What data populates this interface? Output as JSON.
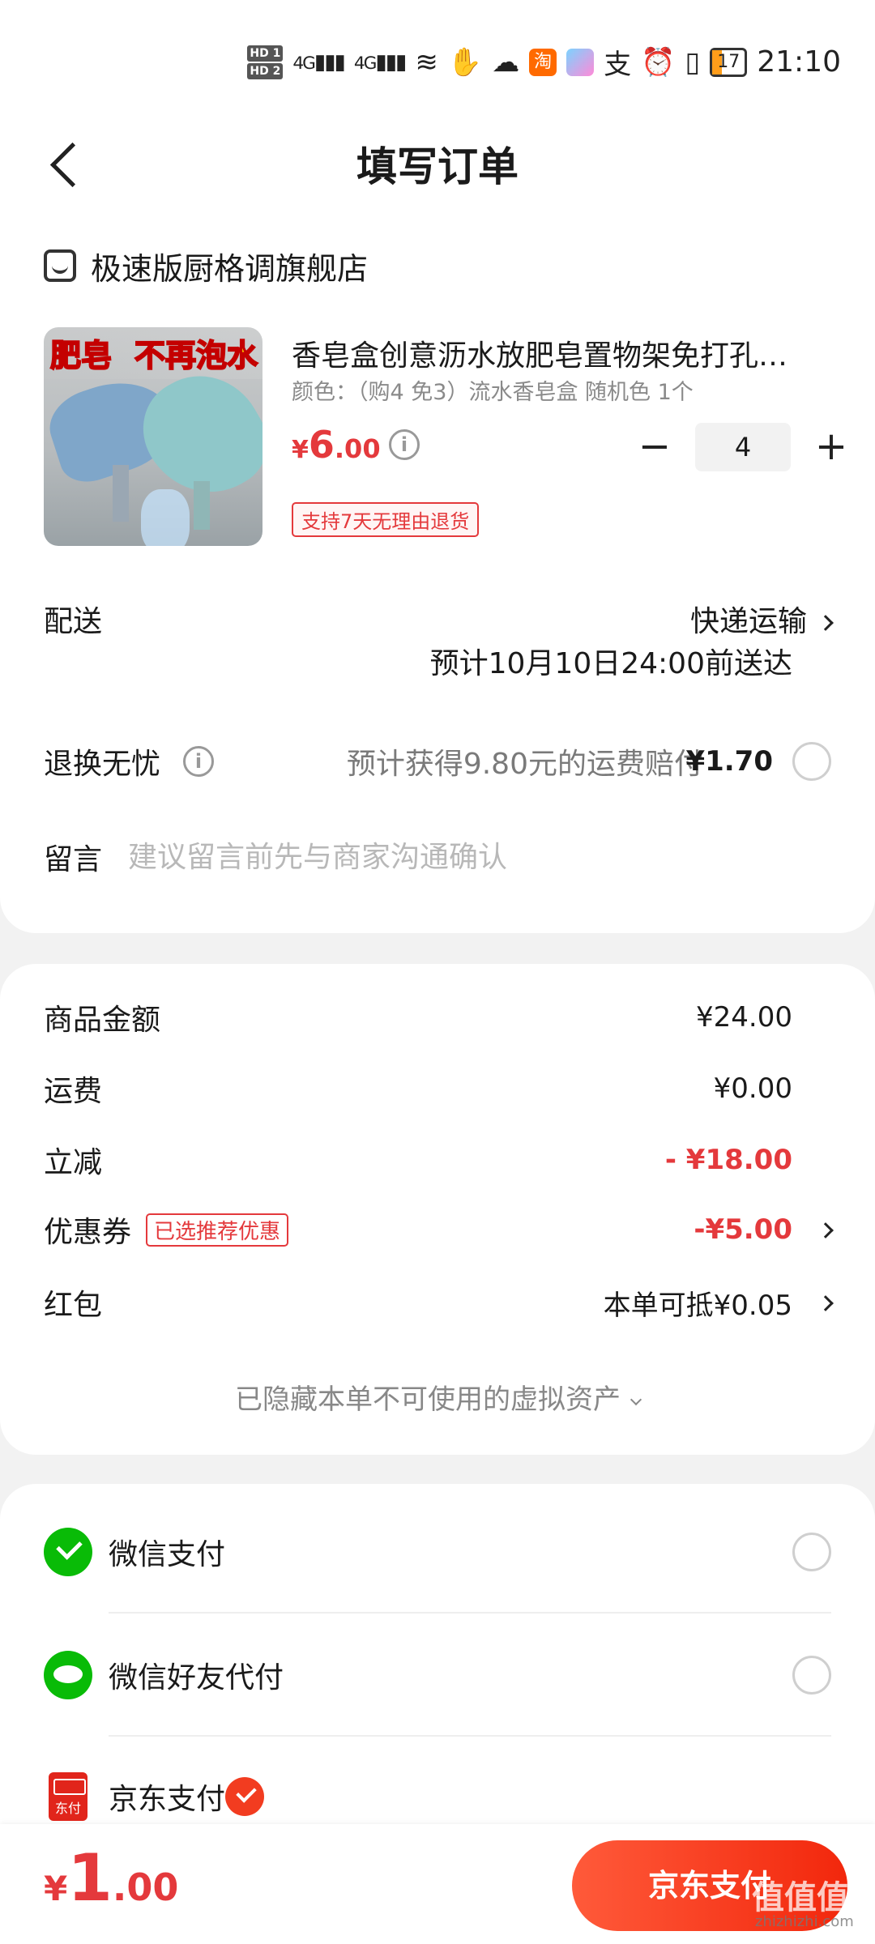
{
  "statusbar": {
    "hd1": "HD 1",
    "hd2": "HD 2",
    "sig1": "4G",
    "sig2": "4G",
    "taobao_glyph": "淘",
    "alipay_glyph": "支",
    "battery": "17",
    "time": "21:10"
  },
  "header": {
    "title": "填写订单"
  },
  "shop": {
    "name": "极速版厨格调旗舰店"
  },
  "product": {
    "image_text_1": "肥皂",
    "image_text_2": "不再泡水",
    "title": "香皂盒创意沥水放肥皂置物架免打孔…",
    "spec": "颜色：（购4 免3）流水香皂盒  随机色 1个",
    "price_currency": "¥",
    "price_int": "6",
    "price_dec": ".00",
    "info_glyph": "i",
    "quantity": "4",
    "minus": "−",
    "plus": "+",
    "return_tag": "支持7天无理由退货"
  },
  "delivery": {
    "label": "配送",
    "method": "快递运输",
    "eta": "预计10月10日24:00前送达"
  },
  "return_insurance": {
    "label": "退换无忧",
    "info_glyph": "i",
    "desc": "预计获得9.80元的运费赔付",
    "price": "¥1.70"
  },
  "message": {
    "label": "留言",
    "placeholder": "建议留言前先与商家沟通确认"
  },
  "summary": {
    "goods_label": "商品金额",
    "goods_value": "¥24.00",
    "freight_label": "运费",
    "freight_value": "¥0.00",
    "discount_label": "立减",
    "discount_value": "- ¥18.00",
    "coupon_label": "优惠券",
    "coupon_tag": "已选推荐优惠",
    "coupon_value": "-¥5.00",
    "redpacket_label": "红包",
    "redpacket_value": "本单可抵¥0.05",
    "hidden_assets": "已隐藏本单不可使用的虚拟资产"
  },
  "payment": {
    "wechat": "微信支付",
    "wechat_friend": "微信好友代付",
    "jd": "京东支付",
    "jd_icon_text": "东付",
    "selected": "jd"
  },
  "bottom": {
    "total_currency": "¥",
    "total_int": "1",
    "total_dec": ".00",
    "pay_button": "京东支付",
    "watermark": "值值值",
    "watermark_sub": "zhizhizhi.com"
  },
  "colors": {
    "accent": "#e4393c",
    "pay_button": "#f2270c",
    "wechat_green": "#09bb07"
  }
}
